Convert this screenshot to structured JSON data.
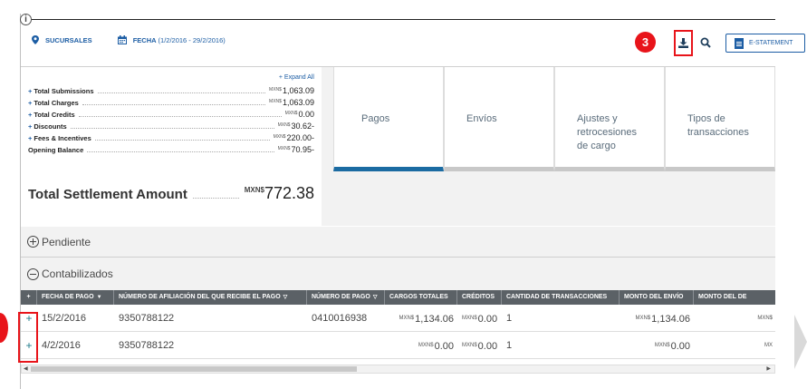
{
  "filters": {
    "branches_label": "SUCURSALES",
    "date_label": "FECHA",
    "date_range": "(1/2/2016 - 29/2/2016)"
  },
  "toolbar": {
    "callout_number": "3",
    "estatement_label": "E-STATEMENT"
  },
  "summary": {
    "expand_all": "+ Expand All",
    "currency": "MXN$",
    "rows": [
      {
        "label": "Total Submissions",
        "amount": "1,063.09",
        "expandable": true
      },
      {
        "label": "Total Charges",
        "amount": "1,063.09",
        "expandable": true
      },
      {
        "label": "Total Credits",
        "amount": "0.00",
        "expandable": true
      },
      {
        "label": "Discounts",
        "amount": "30.62-",
        "expandable": true
      },
      {
        "label": "Fees & Incentives",
        "amount": "220.00-",
        "expandable": true
      },
      {
        "label": "Opening Balance",
        "amount": "70.95-",
        "expandable": false
      }
    ],
    "total_label": "Total Settlement Amount",
    "total_currency": "MXN$",
    "total_amount": "772.38"
  },
  "tabs": [
    {
      "label": "Pagos",
      "active": true
    },
    {
      "label": "Envíos",
      "active": false
    },
    {
      "label": "Ajustes y retrocesiones de cargo",
      "active": false
    },
    {
      "label": "Tipos de transacciones",
      "active": false
    }
  ],
  "sections": {
    "pending": "Pendiente",
    "posted": "Contabilizados"
  },
  "table": {
    "columns": [
      {
        "label": "+",
        "sort": false
      },
      {
        "label": "FECHA DE PAGO",
        "sort": true
      },
      {
        "label": "NÚMERO DE AFILIACIÓN DEL QUE RECIBE EL PAGO",
        "sort": true
      },
      {
        "label": "NÚMERO DE PAGO",
        "sort": true
      },
      {
        "label": "CARGOS TOTALES",
        "sort": false
      },
      {
        "label": "CRÉDITOS",
        "sort": false
      },
      {
        "label": "CANTIDAD DE TRANSACCIONES",
        "sort": false
      },
      {
        "label": "MONTO DEL ENVÍO",
        "sort": false
      },
      {
        "label": "MONTO DEL DE",
        "sort": false
      }
    ],
    "currency": "MXN$",
    "rows": [
      {
        "expander": "+",
        "date": "15/2/2016",
        "merchant": "9350788122",
        "payment_no": "0410016938",
        "charges": "1,134.06",
        "credits": "0.00",
        "count": "1",
        "submission": "1,134.06",
        "last": "MXN$"
      },
      {
        "expander": "+",
        "date": "4/2/2016",
        "merchant": "9350788122",
        "payment_no": "",
        "charges": "0.00",
        "credits": "0.00",
        "count": "1",
        "submission": "0.00",
        "last": "MX"
      }
    ]
  },
  "colors": {
    "accent": "#1c5da4",
    "callout": "#e8141a",
    "header": "#5b6166",
    "active_tab": "#1b6ba2"
  }
}
